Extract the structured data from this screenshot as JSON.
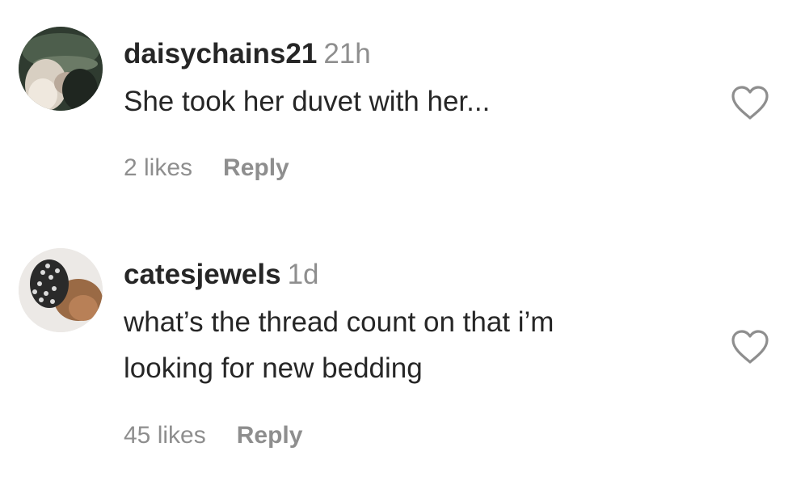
{
  "comments": [
    {
      "username": "daisychains21",
      "time": "21h",
      "text_lines": [
        "She took her duvet with her..."
      ],
      "likes": "2 likes",
      "reply": "Reply",
      "like_icon": "heart-outline-icon"
    },
    {
      "username": "catesjewels",
      "time": "1d",
      "text_lines": [
        "what’s the thread count on that i’m",
        "looking for new bedding"
      ],
      "likes": "45 likes",
      "reply": "Reply",
      "like_icon": "heart-outline-icon"
    }
  ],
  "colors": {
    "text": "#262626",
    "muted": "#8e8e8e",
    "background": "#ffffff"
  }
}
